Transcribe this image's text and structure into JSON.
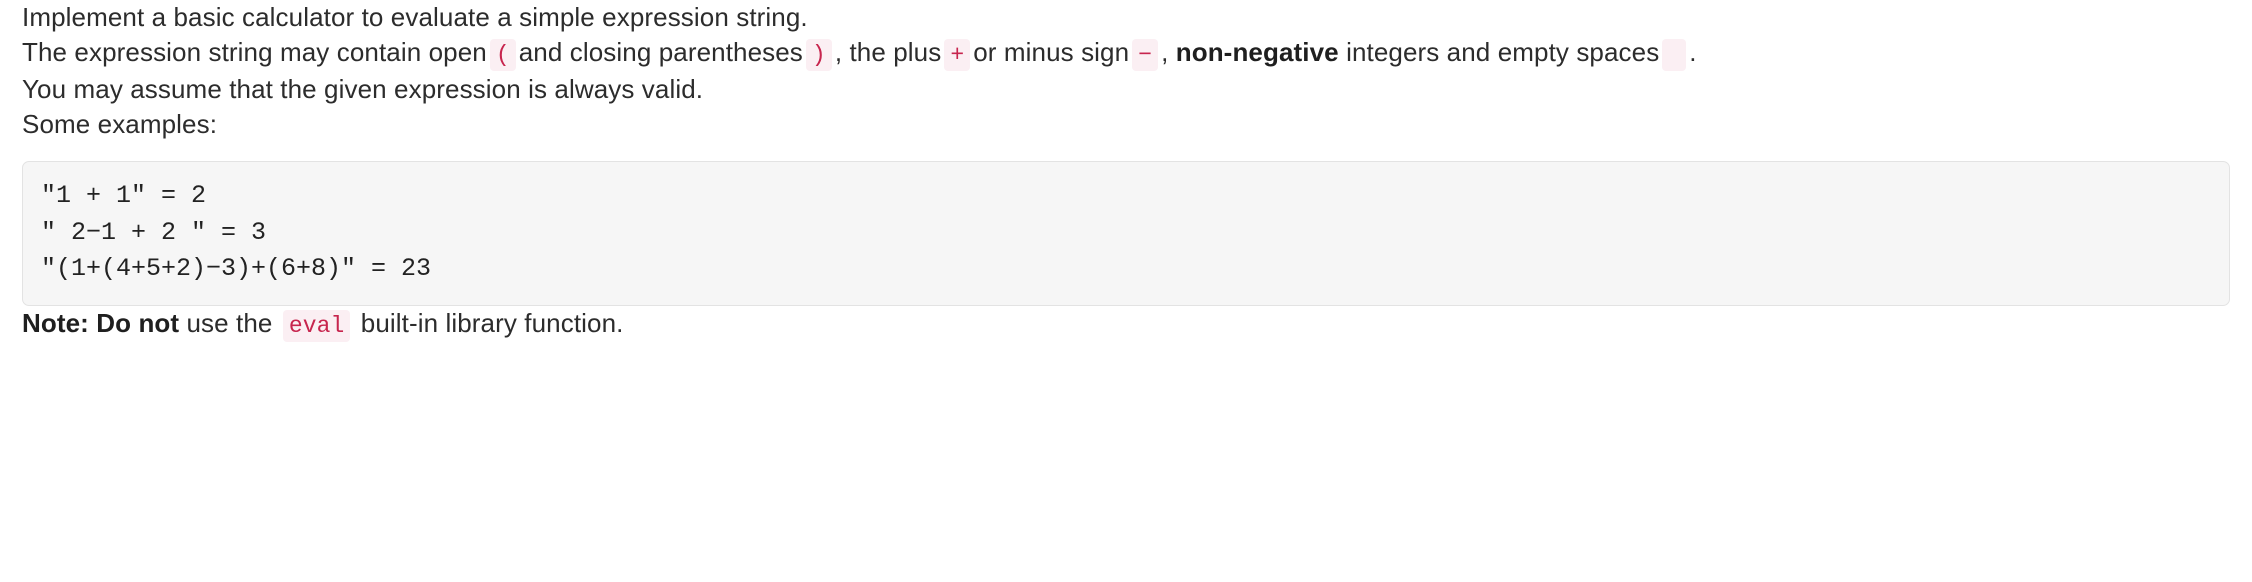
{
  "document": {
    "paragraphs": {
      "intro": "Implement a basic calculator to evaluate a simple expression string.",
      "spec_part1": "The expression string may contain open",
      "spec_part2": "and closing parentheses",
      "spec_part3": ", the plus",
      "spec_part4": "or minus sign",
      "spec_part5": ",",
      "spec_bold": "non-negative",
      "spec_part6": "integers and empty spaces",
      "spec_part7": ".",
      "validity": "You may assume that the given expression is always valid.",
      "examples_label": "Some examples:",
      "note_bold": "Note: Do not",
      "note_part1": "use the",
      "note_part2": "built-in library function."
    },
    "inline_code": {
      "open_paren": "(",
      "close_paren": ")",
      "plus": "+",
      "minus": "−",
      "space": " ",
      "eval": "eval"
    },
    "code_block": {
      "lines": [
        "\"1 + 1\" = 2",
        "\" 2−1 + 2 \" = 3",
        "\"(1+(4+5+2)−3)+(6+8)\" = 23"
      ],
      "text": "\"1 + 1\" = 2\n\" 2−1 + 2 \" = 3\n\"(1+(4+5+2)−3)+(6+8)\" = 23"
    },
    "colors": {
      "page_background": "#ffffff",
      "body_text": "#2c2c2c",
      "inline_code_text": "#c7254e",
      "inline_code_background": "#fbeff3",
      "code_block_background": "#f6f6f6",
      "code_block_border": "#e3e3e3",
      "code_block_text": "#222222"
    }
  }
}
